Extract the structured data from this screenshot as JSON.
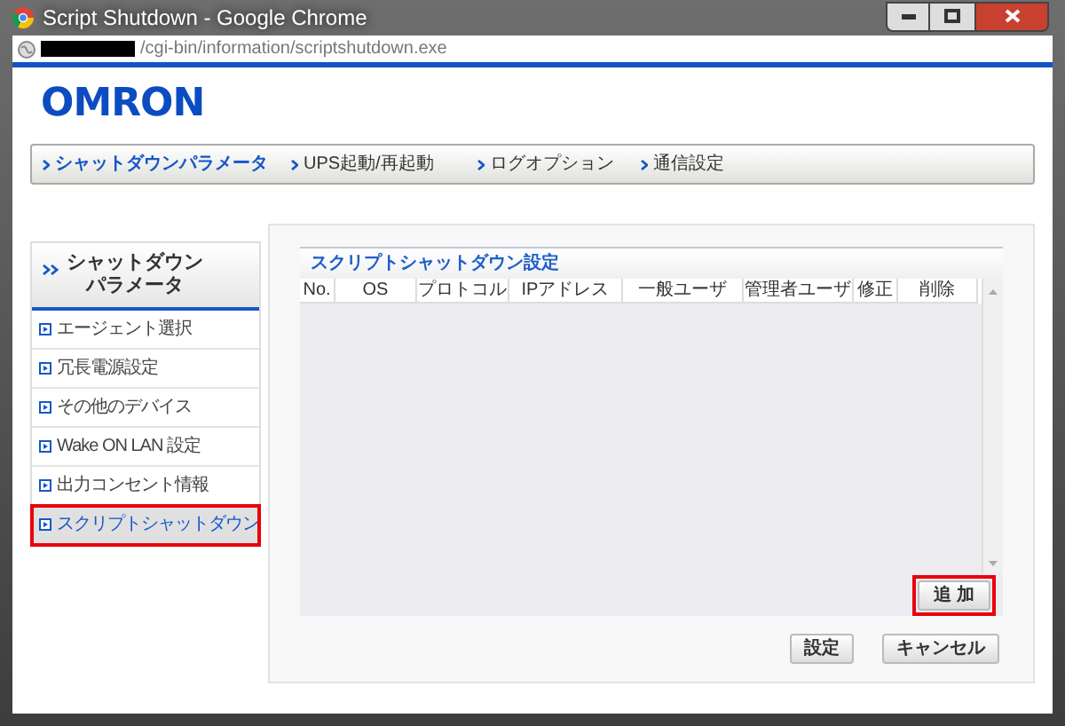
{
  "window": {
    "title": "Script Shutdown - Google Chrome"
  },
  "address_bar": {
    "value": "/cgi-bin/information/scriptshutdown.exe",
    "redacted": true
  },
  "logo": "OMRON",
  "nav": [
    {
      "label": "シャットダウンパラメータ",
      "selected": true
    },
    {
      "label": "UPS起動/再起動",
      "selected": false
    },
    {
      "label": "ログオプション",
      "selected": false
    },
    {
      "label": "通信設定",
      "selected": false
    }
  ],
  "sidebar": {
    "title": "シャットダウンパラメータ",
    "items": [
      {
        "label": "エージェント選択",
        "selected": false,
        "highlighted": false
      },
      {
        "label": "冗長電源設定",
        "selected": false,
        "highlighted": false
      },
      {
        "label": "その他のデバイス",
        "selected": false,
        "highlighted": false
      },
      {
        "label": "Wake ON LAN 設定",
        "selected": false,
        "highlighted": false
      },
      {
        "label": "出力コンセント情報",
        "selected": false,
        "highlighted": false
      },
      {
        "label": "スクリプトシャットダウン",
        "selected": true,
        "highlighted": true
      }
    ]
  },
  "panel": {
    "title": "スクリプトシャットダウン設定",
    "table": {
      "columns": [
        "No.",
        "OS",
        "プロトコル",
        "IPアドレス",
        "一般ユーザ",
        "管理者ユーザ",
        "修正",
        "削除"
      ]
    },
    "add_button": {
      "label": "追 加",
      "highlighted": true
    }
  },
  "buttons": [
    "設定",
    "キャンセル"
  ]
}
